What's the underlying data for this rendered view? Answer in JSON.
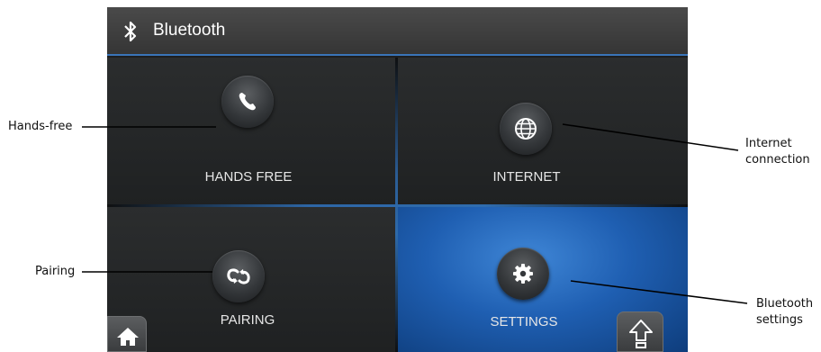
{
  "header": {
    "title": "Bluetooth",
    "icon": "bluetooth-icon"
  },
  "tiles": [
    {
      "label": "HANDS FREE",
      "icon": "phone-icon"
    },
    {
      "label": "INTERNET",
      "icon": "globe-icon"
    },
    {
      "label": "PAIRING",
      "icon": "sync-icon"
    },
    {
      "label": "SETTINGS",
      "icon": "gear-icon",
      "state": "selected"
    }
  ],
  "nav": {
    "home_icon": "home-icon",
    "up_icon": "up-arrow-icon"
  },
  "annotations": {
    "hands_free": "Hands-free",
    "internet_line1": "Internet",
    "internet_line2": "connection",
    "pairing": "Pairing",
    "bt_settings_line1": "Bluetooth",
    "bt_settings_line2": "settings"
  },
  "colors": {
    "accent": "#3a74b8",
    "selected_tile": "#1f5fb2",
    "background": "#1d1f20"
  }
}
